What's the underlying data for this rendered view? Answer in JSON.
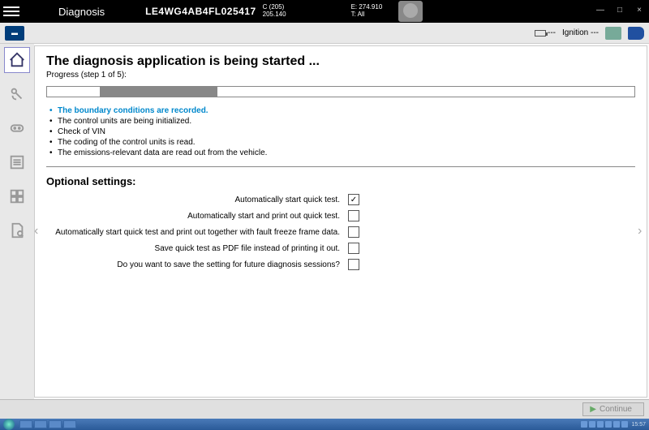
{
  "titlebar": {
    "title": "Diagnosis",
    "vin": "LE4WG4AB4FL025417",
    "info1_line1": "C (205)",
    "info1_line2": "205.140",
    "info2_line1": "E: 274.910",
    "info2_line2": "T: All"
  },
  "toolbar": {
    "battery": "---",
    "ignition": "Ignition ---"
  },
  "content": {
    "heading": "The diagnosis application is being started ...",
    "progress_label": "Progress (step 1 of 5):",
    "progress_percent": 20,
    "steps": [
      {
        "text": "The boundary conditions are recorded.",
        "current": true
      },
      {
        "text": "The control units are being initialized.",
        "current": false
      },
      {
        "text": "Check of VIN",
        "current": false
      },
      {
        "text": "The coding of the control units is read.",
        "current": false
      },
      {
        "text": "The emissions-relevant data are read out from the vehicle.",
        "current": false
      }
    ],
    "optional_title": "Optional settings:",
    "options": [
      {
        "label": "Automatically start quick test.",
        "checked": true
      },
      {
        "label": "Automatically start and print out quick test.",
        "checked": false
      },
      {
        "label": "Automatically start quick test and print out together with fault freeze frame data.",
        "checked": false
      },
      {
        "label": "Save quick test as PDF file instead of printing it out.",
        "checked": false
      },
      {
        "label": "Do you want to save the setting for future diagnosis sessions?",
        "checked": false
      }
    ]
  },
  "footer": {
    "continue": "Continue"
  },
  "taskbar": {
    "time": "15:57"
  }
}
